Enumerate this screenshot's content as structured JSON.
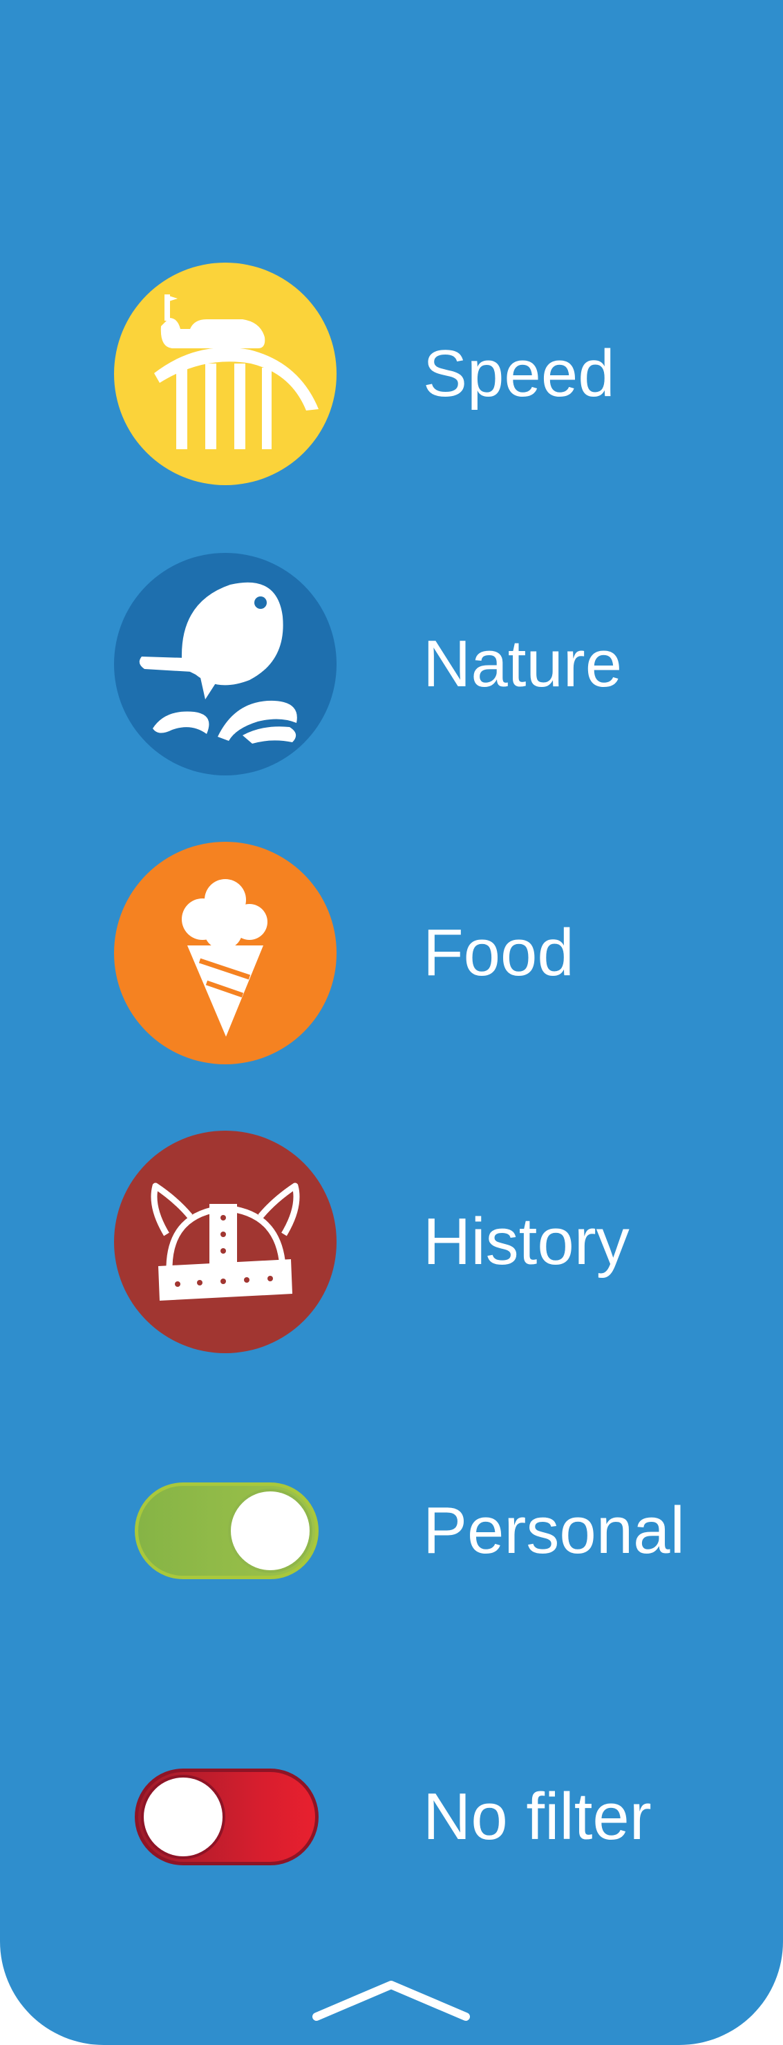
{
  "colors": {
    "panel": "#2f8ecd",
    "speed": "#fbd33a",
    "nature": "#1e6fae",
    "food": "#f58221",
    "history": "#a13631",
    "toggle_on": "#8ab44a",
    "toggle_off": "#d91f2f"
  },
  "filters": [
    {
      "label": "Speed",
      "icon": "roller-coaster-icon"
    },
    {
      "label": "Nature",
      "icon": "fish-icon"
    },
    {
      "label": "Food",
      "icon": "ice-cream-icon"
    },
    {
      "label": "History",
      "icon": "viking-helmet-icon"
    }
  ],
  "toggles": [
    {
      "label": "Personal",
      "state": "on"
    },
    {
      "label": "No filter",
      "state": "off"
    }
  ],
  "footer": {
    "icon": "chevron-up-icon"
  }
}
